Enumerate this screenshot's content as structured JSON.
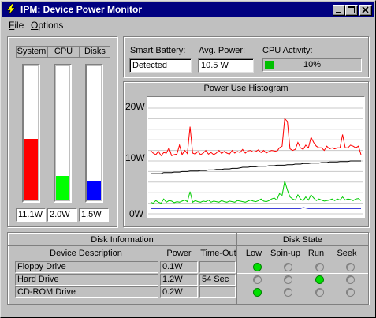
{
  "window": {
    "title": "IPM: Device Power Monitor"
  },
  "menu": {
    "file": "File",
    "file_key": "F",
    "file_rest": "ile",
    "options": "Options",
    "options_key": "O",
    "options_rest": "ptions"
  },
  "bars": {
    "headers": [
      "System",
      "CPU",
      "Disks"
    ],
    "values": [
      "11.1W",
      "2.0W",
      "1.5W"
    ],
    "levels": [
      0.46,
      0.18,
      0.14
    ],
    "colors": [
      "#ff0000",
      "#00ff00",
      "#0000ff"
    ]
  },
  "fields": {
    "smart_battery_label": "Smart Battery:",
    "smart_battery_value": "Detected",
    "avg_power_label": "Avg. Power:",
    "avg_power_value": "10.5 W",
    "cpu_activity_label": "CPU Activity:",
    "cpu_activity_value": "10%",
    "cpu_activity_level": 0.1
  },
  "histogram": {
    "title": "Power Use Histogram",
    "y_labels": [
      "20W",
      "10W",
      "0W"
    ],
    "chart_data": {
      "type": "line",
      "title": "Power Use Histogram",
      "ylim": [
        0,
        20
      ],
      "y_ticks": [
        "0W",
        "10W",
        "20W"
      ],
      "grid": true,
      "series": [
        {
          "color": "#ff0000",
          "values": [
            12,
            11.5,
            11.2,
            11.8,
            11,
            11.6,
            11.5,
            12.5,
            11,
            11.2,
            11.3,
            13,
            11.2,
            12,
            11.4,
            16.5,
            11.5,
            11.3,
            11.8,
            11.2,
            11.5,
            12,
            11.3,
            11.6,
            11.2,
            11.5,
            12,
            11.4,
            11.8,
            11.5,
            11.3,
            12,
            11.5,
            11.8,
            11.6,
            12.2,
            11.5,
            11.9,
            12,
            11.7,
            11.8,
            12.1,
            11.6,
            12,
            11.5,
            11.8,
            12,
            11.9,
            11.8,
            12.5,
            12.8,
            18,
            17.5,
            12.3,
            12,
            12.2,
            13.5,
            12.5,
            12.2,
            13,
            12.5,
            14.5,
            13.5,
            12.8,
            12.5,
            12.5,
            12,
            12.8,
            12.3,
            12.5,
            12.3,
            12.5,
            12.5,
            15,
            12.5,
            12.5,
            13,
            12.8,
            12.5,
            12.8,
            11.2
          ]
        },
        {
          "color": "#000000",
          "values": [
            7.6,
            7.6,
            7.6,
            7.6,
            7.6,
            7.8,
            7.8,
            7.8,
            7.8,
            7.9,
            7.9,
            7.9,
            8,
            8,
            8,
            8.1,
            8.1,
            8.1,
            8.1,
            8.2,
            8.2,
            8.2,
            8.3,
            8.3,
            8.3,
            8.4,
            8.4,
            8.4,
            8.5,
            8.5,
            8.5,
            8.6,
            8.6,
            8.6,
            8.7,
            8.8,
            8.8,
            8.8,
            8.9,
            8.9,
            8.9,
            9,
            9,
            9,
            9,
            9.1,
            9.1,
            9.1,
            9.2,
            9.2,
            9.2,
            9.2,
            9.3,
            9.3,
            9.3,
            9.4,
            9.4,
            9.4,
            9.5,
            9.5,
            9.5,
            9.6,
            9.6,
            9.6,
            9.6,
            9.7,
            9.7,
            9.7,
            9.8,
            9.8,
            9.8,
            9.8,
            9.9,
            9.9,
            9.9,
            9.9,
            10,
            10,
            10,
            10,
            10
          ]
        },
        {
          "color": "#00cc00",
          "values": [
            2.2,
            2,
            2.5,
            2.2,
            2,
            2.8,
            2.2,
            2.5,
            2.4,
            2.1,
            2.3,
            2.2,
            2.4,
            2.6,
            2.3,
            4.2,
            2.2,
            2.5,
            2.3,
            2.2,
            2.4,
            2.3,
            2.6,
            2.2,
            2.4,
            2.3,
            2.2,
            2.5,
            2.3,
            2.2,
            2.4,
            2.3,
            2.2,
            2.5,
            2.4,
            2.3,
            2.2,
            2.4,
            2.6,
            2.4,
            2.3,
            2.5,
            2.8,
            2.4,
            2.3,
            2.5,
            2.8,
            3,
            2.6,
            3.8,
            3.5,
            6.2,
            4.5,
            3.2,
            2.8,
            2.6,
            3.6,
            2.8,
            2.5,
            3.2,
            2.6,
            3.6,
            3,
            2.5,
            2.8,
            2.6,
            2.4,
            2.5,
            2.6,
            2.8,
            2.5,
            2.8,
            2.6,
            3.2,
            2.6,
            2.8,
            2.7,
            2.5,
            2.8,
            2.9,
            2.5
          ]
        },
        {
          "color": "#0000cc",
          "values": [
            1,
            1,
            1,
            1,
            1,
            1,
            1,
            1,
            1,
            1,
            1,
            1,
            1,
            1,
            1,
            1,
            1,
            1,
            1,
            1,
            1,
            1,
            1,
            1,
            1,
            1,
            1,
            1,
            1,
            1,
            1,
            1,
            1,
            1,
            1,
            1,
            1,
            1,
            1,
            1,
            1,
            1,
            1,
            1,
            1,
            1,
            1,
            1,
            1,
            1,
            1,
            1,
            1,
            1,
            1,
            1,
            1,
            1,
            1.2,
            1.1,
            1,
            1,
            1,
            1,
            1,
            1,
            1,
            1,
            1,
            1,
            1,
            1,
            1,
            1,
            1,
            1,
            1,
            1,
            1,
            1,
            1
          ]
        }
      ]
    }
  },
  "disk_info": {
    "title": "Disk Information",
    "columns": [
      "Device Description",
      "Power",
      "Time-Out"
    ],
    "rows": [
      {
        "name": "Floppy Drive",
        "power": "0.1W",
        "timeout": ""
      },
      {
        "name": "Hard Drive",
        "power": "1.2W",
        "timeout": "54 Sec"
      },
      {
        "name": "CD-ROM Drive",
        "power": "0.2W",
        "timeout": ""
      }
    ]
  },
  "disk_state": {
    "title": "Disk State",
    "columns": [
      "Low",
      "Spin-up",
      "Run",
      "Seek"
    ],
    "rows": [
      [
        true,
        false,
        false,
        false
      ],
      [
        false,
        false,
        true,
        false
      ],
      [
        true,
        false,
        false,
        false
      ]
    ],
    "on_color": "#00e000"
  }
}
